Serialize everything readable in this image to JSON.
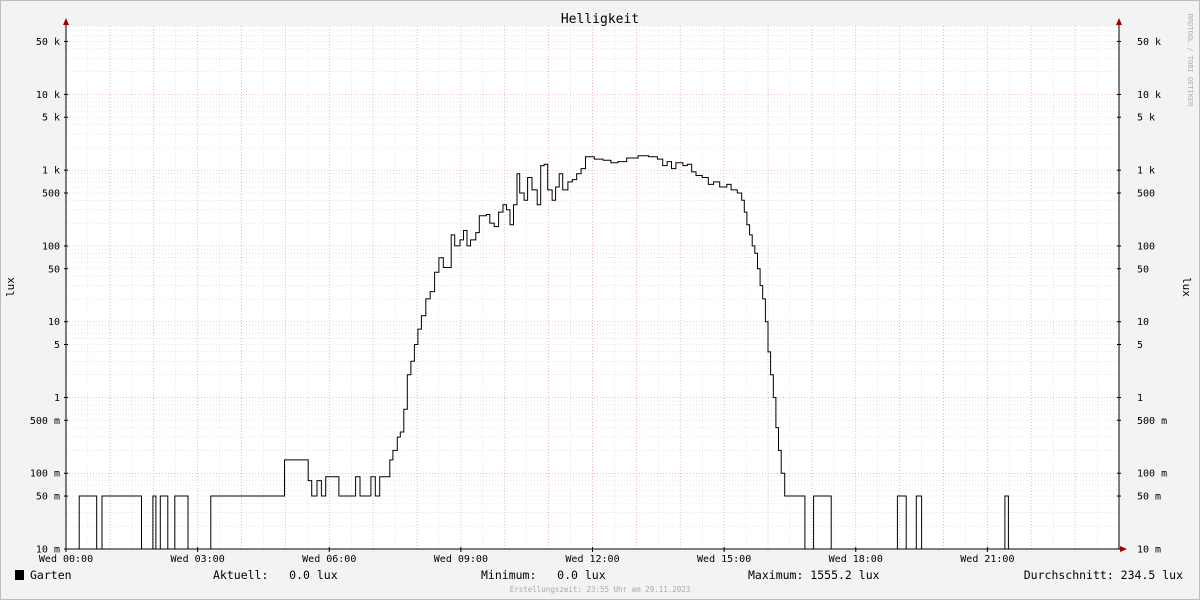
{
  "chart_data": {
    "type": "line",
    "title": "Helligkeit",
    "ylabel": "lux",
    "yscale": "log",
    "ylim": [
      0.01,
      80000
    ],
    "xlim": [
      0,
      24
    ],
    "yticks": [
      {
        "v": 50000,
        "label": "50 k"
      },
      {
        "v": 10000,
        "label": "10 k"
      },
      {
        "v": 5000,
        "label": "5 k"
      },
      {
        "v": 1000,
        "label": "1 k"
      },
      {
        "v": 500,
        "label": "500"
      },
      {
        "v": 100,
        "label": "100"
      },
      {
        "v": 50,
        "label": "50"
      },
      {
        "v": 10,
        "label": "10"
      },
      {
        "v": 5,
        "label": "5"
      },
      {
        "v": 1,
        "label": "1"
      },
      {
        "v": 0.5,
        "label": "500 m"
      },
      {
        "v": 0.1,
        "label": "100 m"
      },
      {
        "v": 0.05,
        "label": "50 m"
      },
      {
        "v": 0.01,
        "label": "10 m"
      }
    ],
    "xticks": [
      {
        "v": 0,
        "label": "Wed 00:00"
      },
      {
        "v": 3,
        "label": "Wed 03:00"
      },
      {
        "v": 6,
        "label": "Wed 06:00"
      },
      {
        "v": 9,
        "label": "Wed 09:00"
      },
      {
        "v": 12,
        "label": "Wed 12:00"
      },
      {
        "v": 15,
        "label": "Wed 15:00"
      },
      {
        "v": 18,
        "label": "Wed 18:00"
      },
      {
        "v": 21,
        "label": "Wed 21:00"
      }
    ],
    "grid": true,
    "series": [
      {
        "name": "Garten",
        "color": "#000000",
        "points": [
          [
            0.3,
            0.01
          ],
          [
            0.3,
            0.05
          ],
          [
            0.7,
            0.05
          ],
          [
            0.7,
            0.01
          ],
          [
            0.82,
            0.01
          ],
          [
            0.82,
            0.05
          ],
          [
            1.72,
            0.05
          ],
          [
            1.72,
            0.01
          ],
          [
            1.98,
            0.01
          ],
          [
            1.98,
            0.05
          ],
          [
            2.05,
            0.05
          ],
          [
            2.05,
            0.01
          ],
          [
            2.15,
            0.01
          ],
          [
            2.15,
            0.05
          ],
          [
            2.32,
            0.05
          ],
          [
            2.32,
            0.01
          ],
          [
            2.48,
            0.01
          ],
          [
            2.48,
            0.05
          ],
          [
            2.78,
            0.05
          ],
          [
            2.78,
            0.01
          ],
          [
            3.3,
            0.01
          ],
          [
            3.3,
            0.05
          ],
          [
            4.98,
            0.05
          ],
          [
            4.98,
            0.15
          ],
          [
            5.52,
            0.15
          ],
          [
            5.52,
            0.08
          ],
          [
            5.6,
            0.08
          ],
          [
            5.6,
            0.05
          ],
          [
            5.72,
            0.05
          ],
          [
            5.72,
            0.08
          ],
          [
            5.82,
            0.08
          ],
          [
            5.82,
            0.05
          ],
          [
            5.92,
            0.05
          ],
          [
            5.92,
            0.09
          ],
          [
            6.22,
            0.09
          ],
          [
            6.22,
            0.05
          ],
          [
            6.6,
            0.05
          ],
          [
            6.6,
            0.09
          ],
          [
            6.7,
            0.09
          ],
          [
            6.7,
            0.05
          ],
          [
            6.95,
            0.05
          ],
          [
            6.95,
            0.09
          ],
          [
            7.05,
            0.09
          ],
          [
            7.05,
            0.05
          ],
          [
            7.15,
            0.05
          ],
          [
            7.15,
            0.09
          ],
          [
            7.38,
            0.09
          ],
          [
            7.38,
            0.15
          ],
          [
            7.45,
            0.15
          ],
          [
            7.45,
            0.2
          ],
          [
            7.55,
            0.2
          ],
          [
            7.55,
            0.3
          ],
          [
            7.62,
            0.3
          ],
          [
            7.62,
            0.35
          ],
          [
            7.7,
            0.35
          ],
          [
            7.7,
            0.7
          ],
          [
            7.78,
            0.7
          ],
          [
            7.78,
            2
          ],
          [
            7.86,
            2
          ],
          [
            7.86,
            3
          ],
          [
            7.94,
            3
          ],
          [
            7.94,
            5
          ],
          [
            8.02,
            5
          ],
          [
            8.02,
            8
          ],
          [
            8.1,
            8
          ],
          [
            8.1,
            12
          ],
          [
            8.2,
            12
          ],
          [
            8.2,
            20
          ],
          [
            8.3,
            20
          ],
          [
            8.3,
            25
          ],
          [
            8.4,
            25
          ],
          [
            8.4,
            45
          ],
          [
            8.5,
            45
          ],
          [
            8.5,
            70
          ],
          [
            8.6,
            70
          ],
          [
            8.6,
            52
          ],
          [
            8.78,
            52
          ],
          [
            8.78,
            140
          ],
          [
            8.86,
            140
          ],
          [
            8.86,
            100
          ],
          [
            8.98,
            100
          ],
          [
            8.98,
            120
          ],
          [
            9.06,
            120
          ],
          [
            9.06,
            160
          ],
          [
            9.14,
            160
          ],
          [
            9.14,
            100
          ],
          [
            9.22,
            100
          ],
          [
            9.22,
            120
          ],
          [
            9.34,
            120
          ],
          [
            9.34,
            150
          ],
          [
            9.42,
            150
          ],
          [
            9.42,
            250
          ],
          [
            9.58,
            250
          ],
          [
            9.58,
            260
          ],
          [
            9.66,
            260
          ],
          [
            9.66,
            200
          ],
          [
            9.76,
            200
          ],
          [
            9.76,
            180
          ],
          [
            9.86,
            180
          ],
          [
            9.86,
            280
          ],
          [
            9.96,
            280
          ],
          [
            9.96,
            350
          ],
          [
            10.04,
            350
          ],
          [
            10.04,
            300
          ],
          [
            10.12,
            300
          ],
          [
            10.12,
            190
          ],
          [
            10.2,
            190
          ],
          [
            10.2,
            350
          ],
          [
            10.28,
            350
          ],
          [
            10.28,
            900
          ],
          [
            10.34,
            900
          ],
          [
            10.34,
            500
          ],
          [
            10.44,
            500
          ],
          [
            10.44,
            400
          ],
          [
            10.52,
            400
          ],
          [
            10.52,
            800
          ],
          [
            10.62,
            800
          ],
          [
            10.62,
            550
          ],
          [
            10.74,
            550
          ],
          [
            10.74,
            350
          ],
          [
            10.82,
            350
          ],
          [
            10.82,
            1150
          ],
          [
            10.9,
            1150
          ],
          [
            10.9,
            1200
          ],
          [
            10.98,
            1200
          ],
          [
            10.98,
            550
          ],
          [
            11.08,
            550
          ],
          [
            11.08,
            400
          ],
          [
            11.16,
            400
          ],
          [
            11.16,
            600
          ],
          [
            11.24,
            600
          ],
          [
            11.24,
            900
          ],
          [
            11.32,
            900
          ],
          [
            11.32,
            550
          ],
          [
            11.44,
            550
          ],
          [
            11.44,
            700
          ],
          [
            11.54,
            700
          ],
          [
            11.54,
            750
          ],
          [
            11.64,
            750
          ],
          [
            11.64,
            900
          ],
          [
            11.74,
            900
          ],
          [
            11.74,
            1050
          ],
          [
            11.84,
            1050
          ],
          [
            11.84,
            1500
          ],
          [
            12.04,
            1500
          ],
          [
            12.04,
            1400
          ],
          [
            12.24,
            1400
          ],
          [
            12.24,
            1350
          ],
          [
            12.42,
            1350
          ],
          [
            12.42,
            1250
          ],
          [
            12.58,
            1250
          ],
          [
            12.58,
            1300
          ],
          [
            12.78,
            1300
          ],
          [
            12.78,
            1450
          ],
          [
            13.04,
            1450
          ],
          [
            13.04,
            1555
          ],
          [
            13.28,
            1555
          ],
          [
            13.28,
            1500
          ],
          [
            13.48,
            1500
          ],
          [
            13.48,
            1400
          ],
          [
            13.6,
            1400
          ],
          [
            13.6,
            1150
          ],
          [
            13.7,
            1150
          ],
          [
            13.7,
            1300
          ],
          [
            13.8,
            1300
          ],
          [
            13.8,
            1050
          ],
          [
            13.9,
            1050
          ],
          [
            13.9,
            1250
          ],
          [
            14.06,
            1250
          ],
          [
            14.06,
            1150
          ],
          [
            14.16,
            1150
          ],
          [
            14.16,
            1200
          ],
          [
            14.26,
            1200
          ],
          [
            14.26,
            950
          ],
          [
            14.36,
            950
          ],
          [
            14.36,
            850
          ],
          [
            14.5,
            850
          ],
          [
            14.5,
            800
          ],
          [
            14.64,
            800
          ],
          [
            14.64,
            650
          ],
          [
            14.76,
            650
          ],
          [
            14.76,
            700
          ],
          [
            14.9,
            700
          ],
          [
            14.9,
            600
          ],
          [
            15.06,
            600
          ],
          [
            15.06,
            650
          ],
          [
            15.16,
            650
          ],
          [
            15.16,
            550
          ],
          [
            15.3,
            550
          ],
          [
            15.3,
            500
          ],
          [
            15.4,
            500
          ],
          [
            15.4,
            400
          ],
          [
            15.46,
            400
          ],
          [
            15.46,
            280
          ],
          [
            15.52,
            280
          ],
          [
            15.52,
            190
          ],
          [
            15.58,
            190
          ],
          [
            15.58,
            140
          ],
          [
            15.64,
            140
          ],
          [
            15.64,
            100
          ],
          [
            15.7,
            100
          ],
          [
            15.7,
            80
          ],
          [
            15.76,
            80
          ],
          [
            15.76,
            50
          ],
          [
            15.82,
            50
          ],
          [
            15.82,
            30
          ],
          [
            15.88,
            30
          ],
          [
            15.88,
            20
          ],
          [
            15.94,
            20
          ],
          [
            15.94,
            10
          ],
          [
            16.0,
            10
          ],
          [
            16.0,
            4
          ],
          [
            16.06,
            4
          ],
          [
            16.06,
            2
          ],
          [
            16.12,
            2
          ],
          [
            16.12,
            1
          ],
          [
            16.18,
            1
          ],
          [
            16.18,
            0.4
          ],
          [
            16.24,
            0.4
          ],
          [
            16.24,
            0.2
          ],
          [
            16.3,
            0.2
          ],
          [
            16.3,
            0.1
          ],
          [
            16.38,
            0.1
          ],
          [
            16.38,
            0.05
          ],
          [
            16.84,
            0.05
          ],
          [
            16.84,
            0.01
          ],
          [
            17.04,
            0.01
          ],
          [
            17.04,
            0.05
          ],
          [
            17.44,
            0.05
          ],
          [
            17.44,
            0.01
          ],
          [
            18.95,
            0.01
          ],
          [
            18.95,
            0.05
          ],
          [
            19.15,
            0.05
          ],
          [
            19.15,
            0.01
          ],
          [
            19.38,
            0.01
          ],
          [
            19.38,
            0.05
          ],
          [
            19.5,
            0.05
          ],
          [
            19.5,
            0.01
          ],
          [
            21.4,
            0.01
          ],
          [
            21.4,
            0.05
          ],
          [
            21.48,
            0.05
          ],
          [
            21.48,
            0.01
          ],
          [
            24.0,
            0.01
          ]
        ]
      }
    ]
  },
  "watermark": "RRDTOOL / TOBI OETIKER",
  "legend": {
    "series_name": "Garten",
    "color": "#000000",
    "current": "Aktuell:   0.0 lux",
    "minimum": "Minimum:   0.0 lux",
    "maximum": "Maximum: 1555.2 lux",
    "average": "Durchschnitt: 234.5 lux"
  },
  "created": "Erstellungszeit: 23:55 Uhr am 29.11.2023"
}
